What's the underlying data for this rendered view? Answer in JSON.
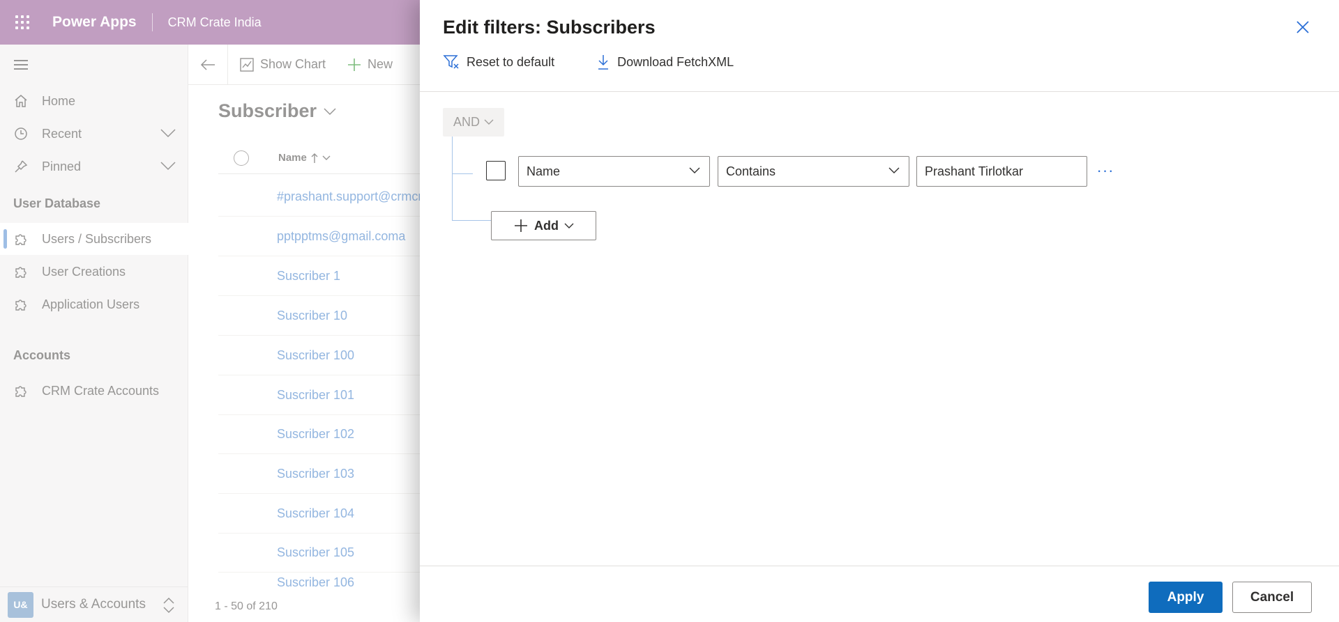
{
  "topbar": {
    "app_name": "Power Apps",
    "environment": "CRM Crate India",
    "color": "#a06aa0"
  },
  "sidebar": {
    "items": [
      {
        "label": "Home",
        "icon": "home-icon"
      },
      {
        "label": "Recent",
        "icon": "clock-icon"
      },
      {
        "label": "Pinned",
        "icon": "pin-icon"
      }
    ],
    "groups": [
      {
        "title": "User Database",
        "items": [
          {
            "label": "Users / Subscribers",
            "icon": "puzzle-icon",
            "selected": true
          },
          {
            "label": "User Creations",
            "icon": "puzzle-icon"
          },
          {
            "label": "Application Users",
            "icon": "puzzle-icon"
          }
        ]
      },
      {
        "title": "Accounts",
        "items": [
          {
            "label": "CRM Crate Accounts",
            "icon": "puzzle-icon"
          }
        ]
      }
    ],
    "area": {
      "badge": "U&",
      "label": "Users & Accounts"
    }
  },
  "main": {
    "commands": {
      "show_chart": "Show Chart",
      "new": "New"
    },
    "view_title": "Subscriber",
    "column_name": "Name",
    "rows": [
      "#prashant.support@crmcrate.com",
      "pptpptms@gmail.coma",
      "Suscriber 1",
      "Suscriber 10",
      "Suscriber 100",
      "Suscriber 101",
      "Suscriber 102",
      "Suscriber 103",
      "Suscriber 104",
      "Suscriber 105",
      "Suscriber 106"
    ],
    "pager": "1 - 50 of 210"
  },
  "panel": {
    "title": "Edit filters: Subscribers",
    "reset_label": "Reset to default",
    "download_label": "Download FetchXML",
    "group_operator": "AND",
    "condition": {
      "field": "Name",
      "operator": "Contains",
      "value": "Prashant Tirlotkar"
    },
    "more_label": "···",
    "add_label": "Add",
    "apply_label": "Apply",
    "cancel_label": "Cancel",
    "accent_color": "#0f6cbd"
  }
}
